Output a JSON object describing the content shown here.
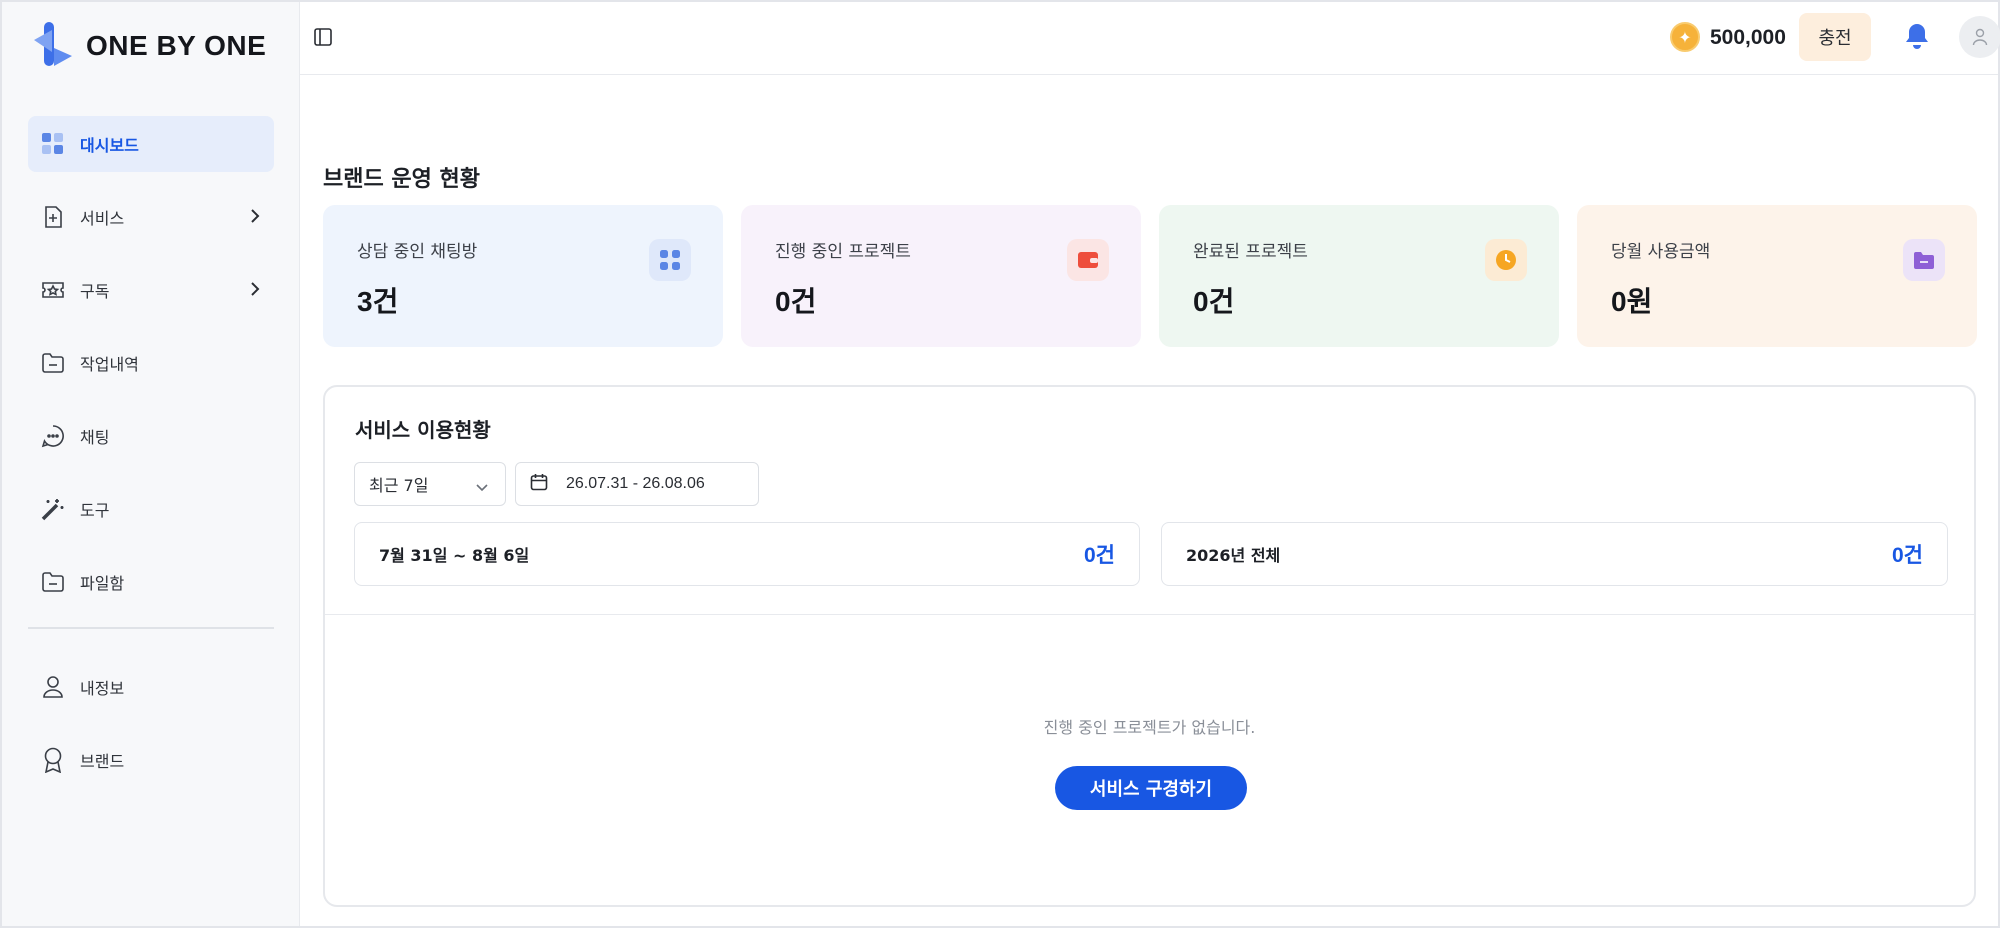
{
  "brand": {
    "logo_text": "ONE BY ONE"
  },
  "sidebar": {
    "items": [
      {
        "label": "대시보드",
        "icon": "dashboard-grid-icon",
        "active": true
      },
      {
        "label": "서비스",
        "icon": "add-document-icon",
        "has_chevron": true
      },
      {
        "label": "구독",
        "icon": "ticket-icon",
        "has_chevron": true
      },
      {
        "label": "작업내역",
        "icon": "folder-icon"
      },
      {
        "label": "채팅",
        "icon": "chat-bubble-icon"
      },
      {
        "label": "도구",
        "icon": "magic-wand-icon"
      },
      {
        "label": "파일함",
        "icon": "folder-icon"
      }
    ],
    "bottom_items": [
      {
        "label": "내정보",
        "icon": "user-icon"
      },
      {
        "label": "브랜드",
        "icon": "award-ribbon-icon"
      }
    ]
  },
  "topbar": {
    "balance": "500,000",
    "charge_label": "충전"
  },
  "main": {
    "section_title": "브랜드 운영 현황",
    "stats": [
      {
        "label": "상담 중인 채팅방",
        "value": "3건",
        "icon": "grid-icon",
        "bg": "#eef4fd",
        "icon_bg": "#dfe8fa",
        "icon_color": "#5b86e5"
      },
      {
        "label": "진행 중인 프로젝트",
        "value": "0건",
        "icon": "wallet-icon",
        "bg": "#f8f2fb",
        "icon_bg": "#fbe5e4",
        "icon_color": "#ee4e3c"
      },
      {
        "label": "완료된 프로젝트",
        "value": "0건",
        "icon": "clock-icon",
        "bg": "#eef7f1",
        "icon_bg": "#fcebd4",
        "icon_color": "#f6a623"
      },
      {
        "label": "당월 사용금액",
        "value": "0원",
        "icon": "folder-icon",
        "bg": "#fdf3ea",
        "icon_bg": "#ece3f8",
        "icon_color": "#8e5fd6"
      }
    ],
    "usage": {
      "title": "서비스 이용현황",
      "period_value": "최근 7일",
      "date_range": "26.07.31 - 26.08.06",
      "summary": [
        {
          "label": "7월 31일 ~ 8월 6일",
          "value": "0건"
        },
        {
          "label": "2026년 전체",
          "value": "0건"
        }
      ],
      "empty_text": "진행 중인 프로젝트가 없습니다.",
      "cta_label": "서비스 구경하기"
    }
  },
  "colors": {
    "accent": "#1857e3",
    "active_bg": "#e6edfb"
  }
}
